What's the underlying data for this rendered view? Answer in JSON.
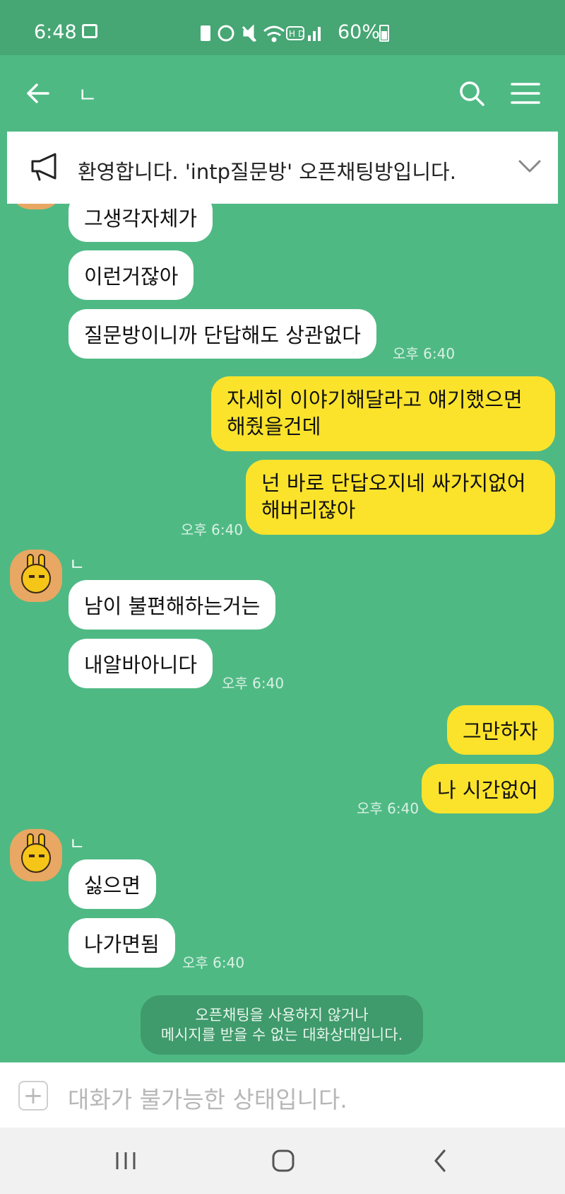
{
  "status_bar": {
    "time": "6:48",
    "battery": "60%",
    "icons": [
      "gallery-icon",
      "battery-saver-icon",
      "alarm-icon",
      "mute-icon",
      "wifi-icon",
      "hd-icon",
      "signal-icon"
    ]
  },
  "header": {
    "title": "ㄴ",
    "icons": [
      "back-arrow-icon",
      "search-icon",
      "menu-icon"
    ]
  },
  "notice": {
    "text": "환영합니다. 'intp질문방' 오픈채팅방입니다."
  },
  "messages": {
    "m1": {
      "text": "그생각자체가"
    },
    "m2": {
      "text": "이런거잖아"
    },
    "m3": {
      "text": "질문방이니까 단답해도 상관없다",
      "time": "오후 6:40"
    },
    "m4": {
      "text": "자세히 이야기해달라고 얘기했으면 해줬을건데"
    },
    "m5": {
      "text": "넌 바로 단답오지네 싸가지없어 해버리잖아",
      "time": "오후 6:40"
    },
    "g2_sender": "ㄴ",
    "m6": {
      "text": "남이 불편해하는거는"
    },
    "m7": {
      "text": "내알바아니다",
      "time": "오후 6:40"
    },
    "m8": {
      "text": "그만하자"
    },
    "m9": {
      "text": "나 시간없어",
      "time": "오후 6:40"
    },
    "g3_sender": "ㄴ",
    "m10": {
      "text": "싫으면"
    },
    "m11": {
      "text": "나가면됨",
      "time": "오후 6:40"
    }
  },
  "system_message": {
    "line1": "오픈채팅을 사용하지 않거나",
    "line2": "메시지를 받을 수 없는 대화상대입니다."
  },
  "input_bar": {
    "placeholder": "대화가 불가능한 상태입니다."
  },
  "colors": {
    "chat_background": "#4fb984",
    "status_bar": "#46a674",
    "outgoing_bubble": "#fbe32c",
    "incoming_bubble": "#ffffff"
  },
  "nav_bar": {
    "icons": [
      "recent-apps-icon",
      "home-icon",
      "nav-back-icon"
    ]
  }
}
